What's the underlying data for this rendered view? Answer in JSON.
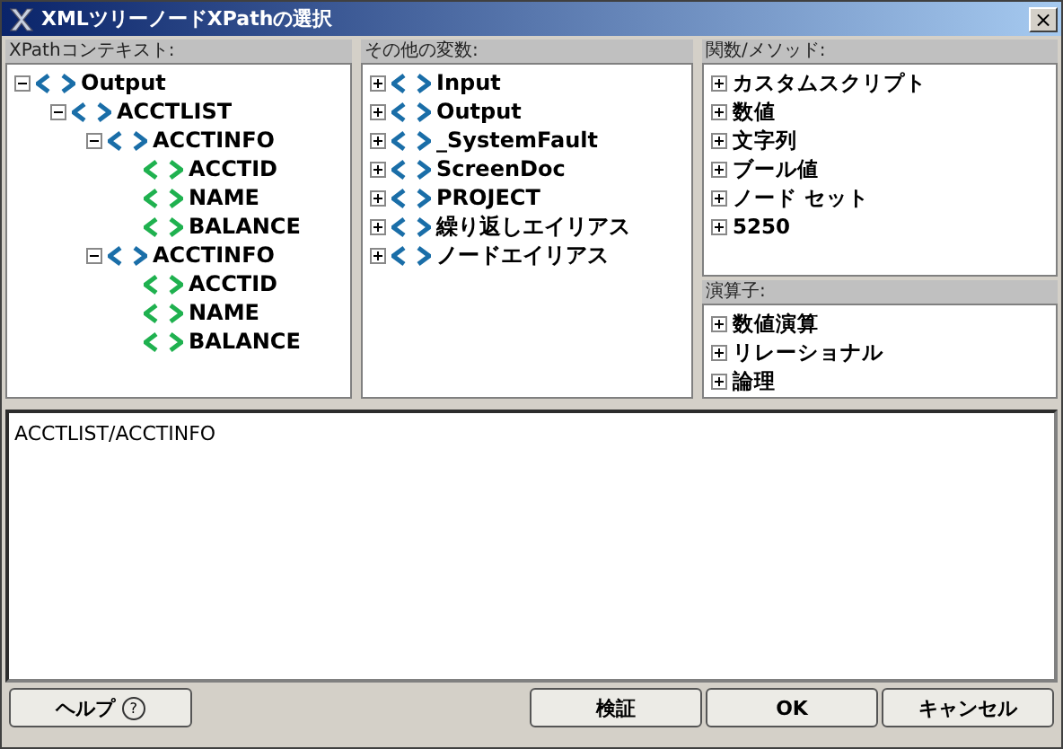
{
  "window": {
    "title": "XMLツリーノードXPathの選択",
    "close": "×"
  },
  "context_panel": {
    "label": "XPathコンテキスト:",
    "tree": [
      {
        "label": "Output",
        "color": "#1a6ea8",
        "expanded": true,
        "children": [
          {
            "label": "ACCTLIST",
            "color": "#1a6ea8",
            "expanded": true,
            "children": [
              {
                "label": "ACCTINFO",
                "color": "#1a6ea8",
                "expanded": true,
                "children": [
                  {
                    "label": "ACCTID",
                    "color": "#1fb14f"
                  },
                  {
                    "label": "NAME",
                    "color": "#1fb14f"
                  },
                  {
                    "label": "BALANCE",
                    "color": "#1fb14f"
                  }
                ]
              },
              {
                "label": "ACCTINFO",
                "color": "#1a6ea8",
                "expanded": true,
                "children": [
                  {
                    "label": "ACCTID",
                    "color": "#1fb14f"
                  },
                  {
                    "label": "NAME",
                    "color": "#1fb14f"
                  },
                  {
                    "label": "BALANCE",
                    "color": "#1fb14f"
                  }
                ]
              }
            ]
          }
        ]
      }
    ]
  },
  "variables_panel": {
    "label": "その他の変数:",
    "items": [
      {
        "label": "Input",
        "expanded": false
      },
      {
        "label": "Output",
        "expanded": false
      },
      {
        "label": "_SystemFault",
        "expanded": false
      },
      {
        "label": "ScreenDoc",
        "expanded": false
      },
      {
        "label": "PROJECT",
        "expanded": false
      },
      {
        "label": "繰り返しエイリアス",
        "expanded": false
      },
      {
        "label": "ノードエイリアス",
        "expanded": false
      }
    ]
  },
  "functions_panel": {
    "label": "関数/メソッド:",
    "items": [
      {
        "label": "カスタムスクリプト",
        "expanded": false
      },
      {
        "label": "数値",
        "expanded": false
      },
      {
        "label": "文字列",
        "expanded": false
      },
      {
        "label": "ブール値",
        "expanded": false
      },
      {
        "label": "ノード セット",
        "expanded": false
      },
      {
        "label": "5250",
        "expanded": false
      }
    ]
  },
  "operators_panel": {
    "label": "演算子:",
    "items": [
      {
        "label": "数値演算",
        "expanded": false
      },
      {
        "label": "リレーショナル",
        "expanded": false
      },
      {
        "label": "論理",
        "expanded": false
      }
    ]
  },
  "expression": {
    "value": "ACCTLIST/ACCTINFO"
  },
  "buttons": {
    "help": "ヘルプ",
    "help_icon": "?",
    "verify": "検証",
    "ok": "OK",
    "cancel": "キャンセル"
  }
}
